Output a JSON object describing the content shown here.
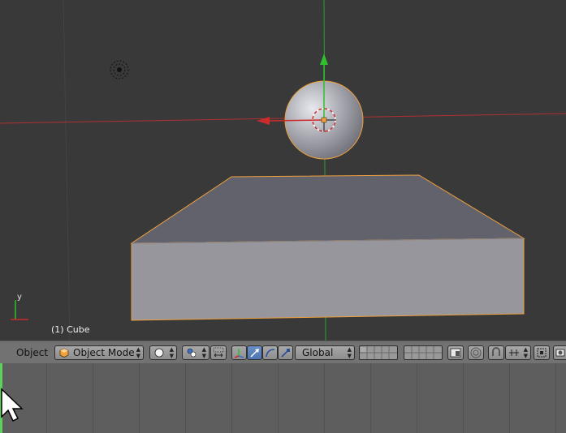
{
  "viewport": {
    "object_label": "(1) Cube",
    "axis_label_y": "y",
    "colors": {
      "background": "#393939",
      "x_axis": "#c83232",
      "y_axis": "#32c832",
      "selection_outline": "#f0a03c"
    },
    "objects": [
      "cube",
      "sphere",
      "lamp",
      "3d-cursor"
    ]
  },
  "header": {
    "menu_label": "Object",
    "mode": "Object Mode",
    "orientation": "Global",
    "icons": [
      "object-mode-cube-icon",
      "viewport-shading-icon",
      "pivot-point-icon",
      "manipulator-toggle-icon",
      "translate-manipulator-icon",
      "rotate-manipulator-icon",
      "scale-manipulator-icon",
      "layers-grid-icon",
      "render-preview-icon",
      "proportional-editing-icon",
      "snap-magnet-icon",
      "snap-element-icon",
      "render-icon"
    ]
  },
  "timeline": {
    "current_frame_indicator": "green-line"
  }
}
